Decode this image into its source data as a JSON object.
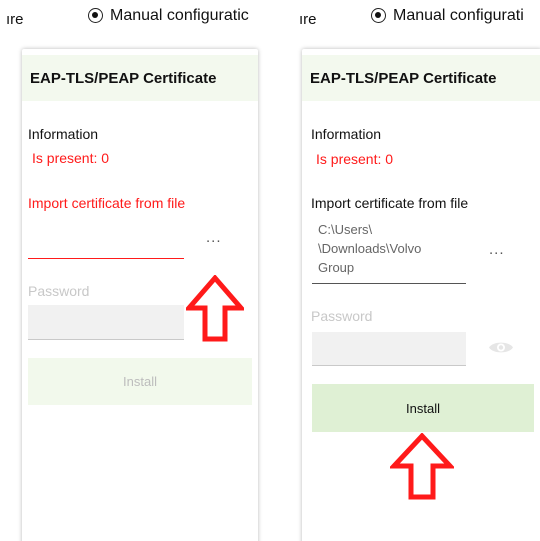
{
  "panels": [
    {
      "header_cut_text": "ıre",
      "radio_label": "Manual configuratic",
      "card_title": "EAP-TLS/PEAP Certificate",
      "info_heading": "Information",
      "is_present_label": "Is present:",
      "is_present_value": "0",
      "import_label": "Import certificate from file",
      "file_value": "",
      "ellipsis": "...",
      "password_placeholder": "Password",
      "install_label": "Install"
    },
    {
      "header_cut_text": "ıre",
      "radio_label": "Manual configurati",
      "card_title": "EAP-TLS/PEAP Certificate",
      "info_heading": "Information",
      "is_present_label": "Is present:",
      "is_present_value": "0",
      "import_label": "Import certificate from file",
      "file_value_lines": [
        "C:\\Users\\",
        "\\Downloads\\Volvo",
        "Group"
      ],
      "ellipsis": "...",
      "password_placeholder": "Password",
      "install_label": "Install"
    }
  ],
  "colors": {
    "accent_red": "#ff1a1a",
    "header_green": "#f3f9ee",
    "button_disabled": "#f2f9ec",
    "button_active": "#dff0d4"
  },
  "icons": [
    "radio-selected-icon",
    "ellipsis-icon",
    "eye-icon",
    "up-arrow-icon"
  ]
}
